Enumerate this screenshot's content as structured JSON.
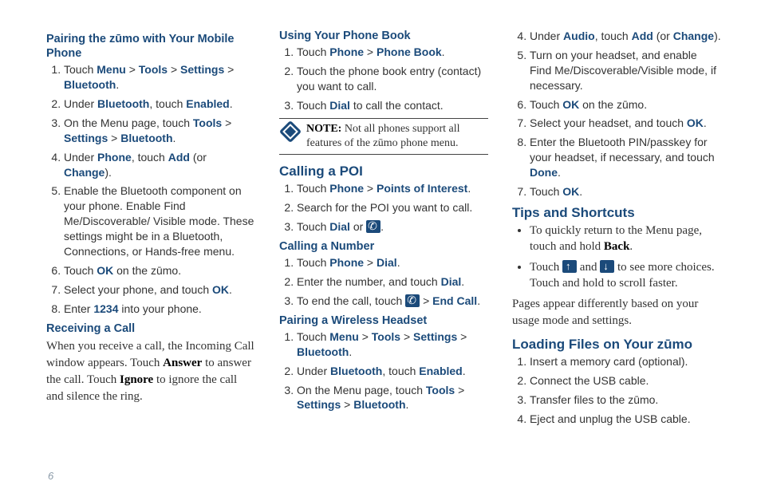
{
  "page_number": "6",
  "col1": {
    "pairing": {
      "title": "Pairing the zūmo with Your Mobile Phone",
      "s1": {
        "pre": "Touch ",
        "a": "Menu",
        "b": "Tools",
        "c": "Settings",
        "d": "Bluetooth",
        "post": "."
      },
      "s2": {
        "pre": "Under ",
        "a": "Bluetooth",
        "mid": ", touch ",
        "b": "Enabled",
        "post": "."
      },
      "s3": {
        "pre": "On the Menu page, touch ",
        "a": "Tools",
        "b": "Settings",
        "c": "Bluetooth",
        "post": "."
      },
      "s4": {
        "pre": "Under ",
        "a": "Phone",
        "mid": ", touch ",
        "b": "Add",
        "mid2": " (or ",
        "c": "Change",
        "post": ")."
      },
      "s5": "Enable the Bluetooth component on your phone. Enable Find Me/Discoverable/ Visible mode. These settings might be in a Bluetooth, Connections, or Hands-free menu.",
      "s6": {
        "pre": "Touch ",
        "a": "OK",
        "post": " on the zūmo."
      },
      "s7": {
        "pre": "Select your phone, and touch ",
        "a": "OK",
        "post": "."
      },
      "s8": {
        "pre": "Enter ",
        "a": "1234",
        "post": " into your phone."
      }
    },
    "receiving": {
      "title": "Receiving a Call",
      "p1a": "When you receive a call, the Incoming Call window appears. Touch ",
      "p1b": "Answer",
      "p1c": " to answer the call. Touch ",
      "p1d": "Ignore",
      "p1e": " to ignore the call and silence the ring."
    }
  },
  "col2": {
    "phonebook": {
      "title": "Using Your Phone Book",
      "s1": {
        "pre": "Touch ",
        "a": "Phone",
        "b": "Phone Book",
        "post": "."
      },
      "s2": "Touch the phone book entry (contact) you want to call.",
      "s3": {
        "pre": "Touch ",
        "a": "Dial",
        "post": " to call the contact."
      },
      "note_label": "NOTE:",
      "note_text": " Not all phones support all features of the zūmo phone menu."
    },
    "poi": {
      "title": "Calling a POI",
      "s1": {
        "pre": "Touch ",
        "a": "Phone",
        "b": "Points of Interest",
        "post": "."
      },
      "s2": "Search for the POI you want to call.",
      "s3": {
        "pre": "Touch ",
        "a": "Dial",
        "mid": " or ",
        "post": "."
      }
    },
    "number": {
      "title": "Calling a Number",
      "s1": {
        "pre": "Touch ",
        "a": "Phone",
        "b": "Dial",
        "post": "."
      },
      "s2": {
        "pre": "Enter the number, and touch ",
        "a": "Dial",
        "post": "."
      },
      "s3": {
        "pre": "To end the call, touch ",
        "mid": " > ",
        "a": "End Call",
        "post": "."
      }
    },
    "headset": {
      "title": "Pairing a Wireless Headset",
      "s1": {
        "pre": "Touch ",
        "a": "Menu",
        "b": "Tools",
        "c": "Settings",
        "d": "Bluetooth",
        "post": "."
      },
      "s2": {
        "pre": "Under ",
        "a": "Bluetooth",
        "mid": ", touch ",
        "b": "Enabled",
        "post": "."
      },
      "s3": {
        "pre": "On the Menu page, touch ",
        "a": "Tools",
        "b": "Settings",
        "c": "Bluetooth",
        "post": "."
      }
    }
  },
  "col3": {
    "headset_cont": {
      "s4": {
        "pre": "Under ",
        "a": "Audio",
        "mid": ", touch ",
        "b": "Add",
        "mid2": " (or ",
        "c": "Change",
        "post": ")."
      },
      "s5": "Turn on your headset, and enable Find Me/Discoverable/Visible mode, if necessary.",
      "s6": {
        "pre": "Touch ",
        "a": "OK",
        "post": " on the zūmo."
      },
      "s7": {
        "pre": "Select your headset, and touch ",
        "a": "OK",
        "post": "."
      },
      "s8": {
        "pre": "Enter the Bluetooth PIN/passkey for your headset, if necessary, and touch ",
        "a": "Done",
        "post": "."
      },
      "s9": {
        "pre": "Touch ",
        "a": "OK",
        "post": "."
      }
    },
    "tips": {
      "title": "Tips and Shortcuts",
      "b1a": "To quickly return to the Menu page, touch and hold ",
      "b1b": "Back",
      "b1c": ".",
      "b2a": "Touch ",
      "b2b": " and ",
      "b2c": " to see more choices. Touch and hold to scroll faster.",
      "p": "Pages appear differently based on your usage mode and settings."
    },
    "loading": {
      "title": "Loading Files on Your zūmo",
      "s1": "Insert a memory card (optional).",
      "s2": "Connect the USB cable.",
      "s3": "Transfer files to the zūmo.",
      "s4": "Eject and unplug the USB cable."
    }
  }
}
